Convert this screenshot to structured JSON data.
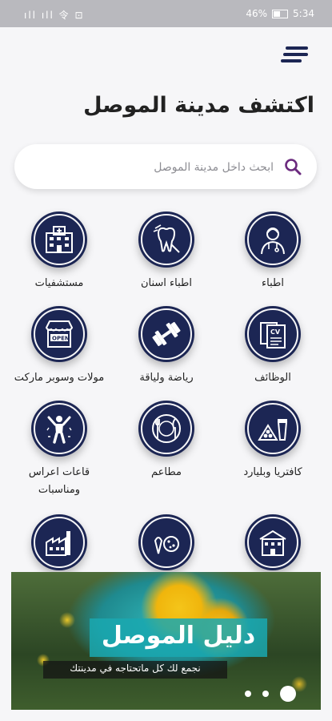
{
  "status_bar": {
    "signal": "ıll ıll 令 ⊡",
    "battery": "46%",
    "time": "5:34"
  },
  "page": {
    "title": "اكتشف مدينة الموصل"
  },
  "search": {
    "placeholder": "ابحث داخل مدينة الموصل"
  },
  "categories": [
    {
      "label": "اطباء",
      "icon": "doctor-icon"
    },
    {
      "label": "اطباء اسنان",
      "icon": "dentist-icon"
    },
    {
      "label": "مستشفيات",
      "icon": "hospital-icon"
    },
    {
      "label": "الوظائف",
      "icon": "cv-icon"
    },
    {
      "label": "رياضة ولياقة",
      "icon": "dumbbell-icon"
    },
    {
      "label": "مولات وسوبر ماركت",
      "icon": "store-open-icon"
    },
    {
      "label": "كافتريا وبليارد",
      "icon": "billiard-coffee-icon"
    },
    {
      "label": "مطاعم",
      "icon": "restaurant-icon"
    },
    {
      "label": "قاعات اعراس ومناسبات",
      "icon": "celebration-icon"
    },
    {
      "label": "",
      "icon": "school-icon"
    },
    {
      "label": "",
      "icon": "sweets-icon"
    },
    {
      "label": "",
      "icon": "factory-icon"
    }
  ],
  "banner": {
    "title": "دليل الموصل",
    "subtitle": "نجمع لك كل ماتحتاجه في مدينتك",
    "slides": 3,
    "active_slide": 1
  },
  "colors": {
    "icon_circle": "#1c2654",
    "banner_accent": "#1aa8b0",
    "background": "#f6f6f8"
  }
}
